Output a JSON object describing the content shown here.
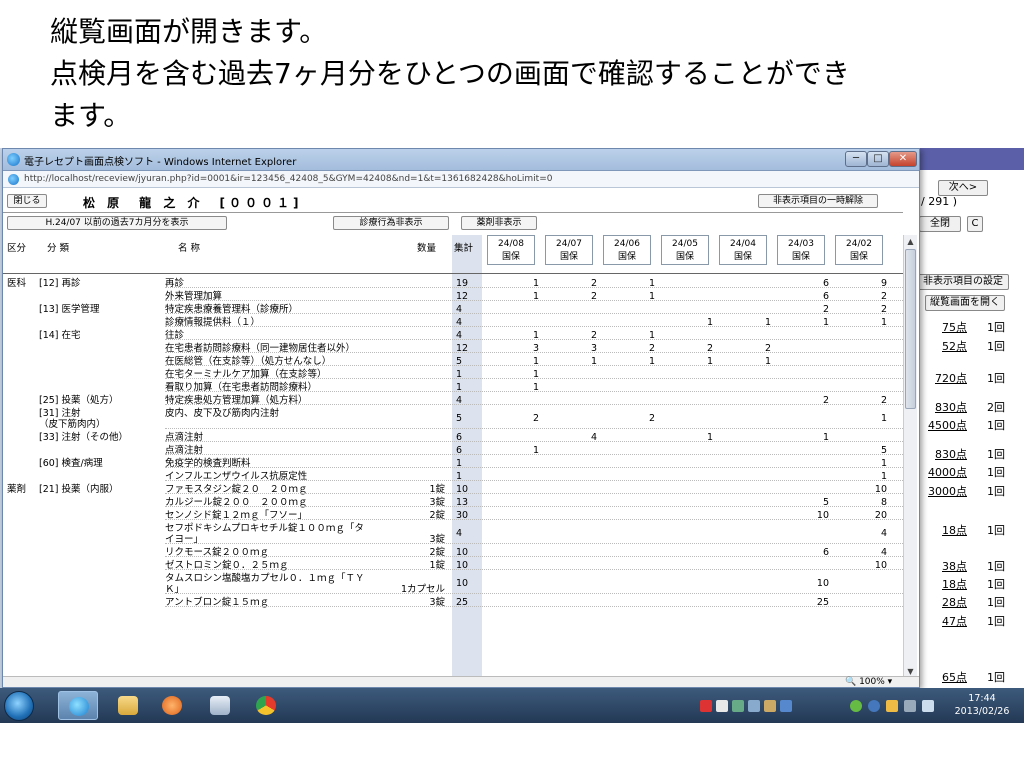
{
  "captions": {
    "line1": "縦覧画面が開きます。",
    "line2": "点検月を含む過去7ヶ月分をひとつの画面で確認することができ",
    "line3": "ます。"
  },
  "window": {
    "title": "電子レセプト画面点検ソフト - Windows Internet Explorer",
    "url": "http://localhost/receview/jyuran.php?id=0001&ir=123456_42408_5&GYM=42408&nd=1&t=1361682428&hoLimit=0",
    "zoom": "100%"
  },
  "toolbar": {
    "close": "閉じる",
    "patient_name": "松 原　龍 之 介　[０００１]",
    "unhide": "非表示項目の一時解除",
    "past_months": "H.24/07 以前の過去7カ月分を表示",
    "hide_shinryo": "診療行為非表示",
    "hide_yakuzai": "薬剤非表示"
  },
  "headers": {
    "kubun": "区分",
    "bunrui": "分 類",
    "meisho": "名 称",
    "suryo": "数量",
    "total": "集計"
  },
  "months": [
    {
      "ym": "24/08",
      "type": "国保"
    },
    {
      "ym": "24/07",
      "type": "国保"
    },
    {
      "ym": "24/06",
      "type": "国保"
    },
    {
      "ym": "24/05",
      "type": "国保"
    },
    {
      "ym": "24/04",
      "type": "国保"
    },
    {
      "ym": "24/03",
      "type": "国保"
    },
    {
      "ym": "24/02",
      "type": "国保"
    }
  ],
  "rows": [
    {
      "kubun": "医科",
      "bunrui": "[12] 再診",
      "name": "再診",
      "qty": "",
      "total": "19",
      "m": [
        "1",
        "2",
        "1",
        "",
        "",
        "6",
        "9"
      ]
    },
    {
      "kubun": "",
      "bunrui": "",
      "name": "外来管理加算",
      "qty": "",
      "total": "12",
      "m": [
        "1",
        "2",
        "1",
        "",
        "",
        "6",
        "2"
      ]
    },
    {
      "kubun": "",
      "bunrui": "[13] 医学管理",
      "name": "特定疾患療養管理料（診療所）",
      "qty": "",
      "total": "4",
      "m": [
        "",
        "",
        "",
        "",
        "",
        "2",
        "2"
      ]
    },
    {
      "kubun": "",
      "bunrui": "",
      "name": "診療情報提供料（１）",
      "qty": "",
      "total": "4",
      "m": [
        "",
        "",
        "",
        "1",
        "1",
        "1",
        "1"
      ]
    },
    {
      "kubun": "",
      "bunrui": "[14] 在宅",
      "name": "往診",
      "qty": "",
      "total": "4",
      "m": [
        "1",
        "2",
        "1",
        "",
        "",
        "",
        ""
      ]
    },
    {
      "kubun": "",
      "bunrui": "",
      "name": "在宅患者訪問診療料（同一建物居住者以外）",
      "qty": "",
      "total": "12",
      "m": [
        "3",
        "3",
        "2",
        "2",
        "2",
        "",
        ""
      ]
    },
    {
      "kubun": "",
      "bunrui": "",
      "name": "在医総管（在支診等）（処方せんなし）",
      "qty": "",
      "total": "5",
      "m": [
        "1",
        "1",
        "1",
        "1",
        "1",
        "",
        ""
      ]
    },
    {
      "kubun": "",
      "bunrui": "",
      "name": "在宅ターミナルケア加算（在支診等）",
      "qty": "",
      "total": "1",
      "m": [
        "1",
        "",
        "",
        "",
        "",
        "",
        ""
      ]
    },
    {
      "kubun": "",
      "bunrui": "",
      "name": "看取り加算（在宅患者訪問診療料）",
      "qty": "",
      "total": "1",
      "m": [
        "1",
        "",
        "",
        "",
        "",
        "",
        ""
      ]
    },
    {
      "kubun": "",
      "bunrui": "[25] 投薬（処方）",
      "name": "特定疾患処方管理加算（処方料）",
      "qty": "",
      "total": "4",
      "m": [
        "",
        "",
        "",
        "",
        "",
        "2",
        "2"
      ]
    },
    {
      "kubun": "",
      "bunrui": "[31] 注射\n（皮下筋肉内）",
      "name": "皮内、皮下及び筋肉内注射",
      "qty": "",
      "total": "5",
      "m": [
        "2",
        "",
        "2",
        "",
        "",
        "",
        "1"
      ],
      "h": 22
    },
    {
      "kubun": "",
      "bunrui": "[33] 注射（その他）",
      "name": "点滴注射",
      "qty": "",
      "total": "6",
      "m": [
        "",
        "4",
        "",
        "1",
        "",
        "1",
        ""
      ]
    },
    {
      "kubun": "",
      "bunrui": "",
      "name": "点滴注射",
      "qty": "",
      "total": "6",
      "m": [
        "1",
        "",
        "",
        "",
        "",
        "",
        "5"
      ]
    },
    {
      "kubun": "",
      "bunrui": "[60] 検査/病理",
      "name": "免疫学的検査判断料",
      "qty": "",
      "total": "1",
      "m": [
        "",
        "",
        "",
        "",
        "",
        "",
        "1"
      ]
    },
    {
      "kubun": "",
      "bunrui": "",
      "name": "インフルエンザウイルス抗原定性",
      "qty": "",
      "total": "1",
      "m": [
        "",
        "",
        "",
        "",
        "",
        "",
        "1"
      ]
    },
    {
      "kubun": "薬剤",
      "bunrui": "[21] 投薬（内服）",
      "name": "ファモスタジン錠２０　２０ｍｇ",
      "qty": "1錠",
      "total": "10",
      "m": [
        "",
        "",
        "",
        "",
        "",
        "",
        "10"
      ]
    },
    {
      "kubun": "",
      "bunrui": "",
      "name": "カルジール錠２００　２００ｍｇ",
      "qty": "3錠",
      "total": "13",
      "m": [
        "",
        "",
        "",
        "",
        "",
        "5",
        "8"
      ]
    },
    {
      "kubun": "",
      "bunrui": "",
      "name": "センノシド錠１２ｍｇ「フソー」",
      "qty": "2錠",
      "total": "30",
      "m": [
        "",
        "",
        "",
        "",
        "",
        "10",
        "20"
      ]
    },
    {
      "kubun": "",
      "bunrui": "",
      "name": "セフポドキシムプロキセチル錠１００ｍｇ「タ\nイヨー」",
      "qty": "3錠",
      "total": "4",
      "m": [
        "",
        "",
        "",
        "",
        "",
        "",
        "4"
      ],
      "h": 22
    },
    {
      "kubun": "",
      "bunrui": "",
      "name": "リクモース錠２００ｍｇ",
      "qty": "2錠",
      "total": "10",
      "m": [
        "",
        "",
        "",
        "",
        "",
        "6",
        "4"
      ]
    },
    {
      "kubun": "",
      "bunrui": "",
      "name": "ゼストロミン錠０．２５ｍｇ",
      "qty": "1錠",
      "total": "10",
      "m": [
        "",
        "",
        "",
        "",
        "",
        "",
        "10"
      ]
    },
    {
      "kubun": "",
      "bunrui": "",
      "name": "タムスロシン塩酸塩カプセル０．１ｍｇ「ＴＹ\nＫ」",
      "qty": "1カプセル",
      "total": "10",
      "m": [
        "",
        "",
        "",
        "",
        "",
        "10",
        ""
      ],
      "h": 22
    },
    {
      "kubun": "",
      "bunrui": "",
      "name": "アントブロン錠１５ｍｇ",
      "qty": "3錠",
      "total": "25",
      "m": [
        "",
        "",
        "",
        "",
        "",
        "25",
        ""
      ]
    }
  ],
  "bg_app": {
    "next": "次へ>",
    "page": "/ 291 )",
    "close_all": "全閉",
    "c": "C",
    "hidden_setting": "非表示項目の設定",
    "open_jyuran": "縦覧画面を開く",
    "points": [
      {
        "pt": "75点",
        "cnt": "1回"
      },
      {
        "pt": "52点",
        "cnt": "1回"
      },
      {
        "pt": "720点",
        "cnt": "1回"
      },
      {
        "pt": "830点",
        "cnt": "2回"
      },
      {
        "pt": "4500点",
        "cnt": "1回"
      },
      {
        "pt": "830点",
        "cnt": "1回"
      },
      {
        "pt": "4000点",
        "cnt": "1回"
      },
      {
        "pt": "3000点",
        "cnt": "1回"
      },
      {
        "pt": "18点",
        "cnt": "1回"
      },
      {
        "pt": "38点",
        "cnt": "1回"
      },
      {
        "pt": "18点",
        "cnt": "1回"
      },
      {
        "pt": "28点",
        "cnt": "1回"
      },
      {
        "pt": "47点",
        "cnt": "1回"
      },
      {
        "pt": "65点",
        "cnt": "1回"
      }
    ]
  },
  "taskbar": {
    "time": "17:44",
    "date": "2013/02/26"
  },
  "colors": {
    "total_column": "#dde3ee",
    "taskbar": "#2c4566",
    "titlebar": "#b3c9e4"
  }
}
